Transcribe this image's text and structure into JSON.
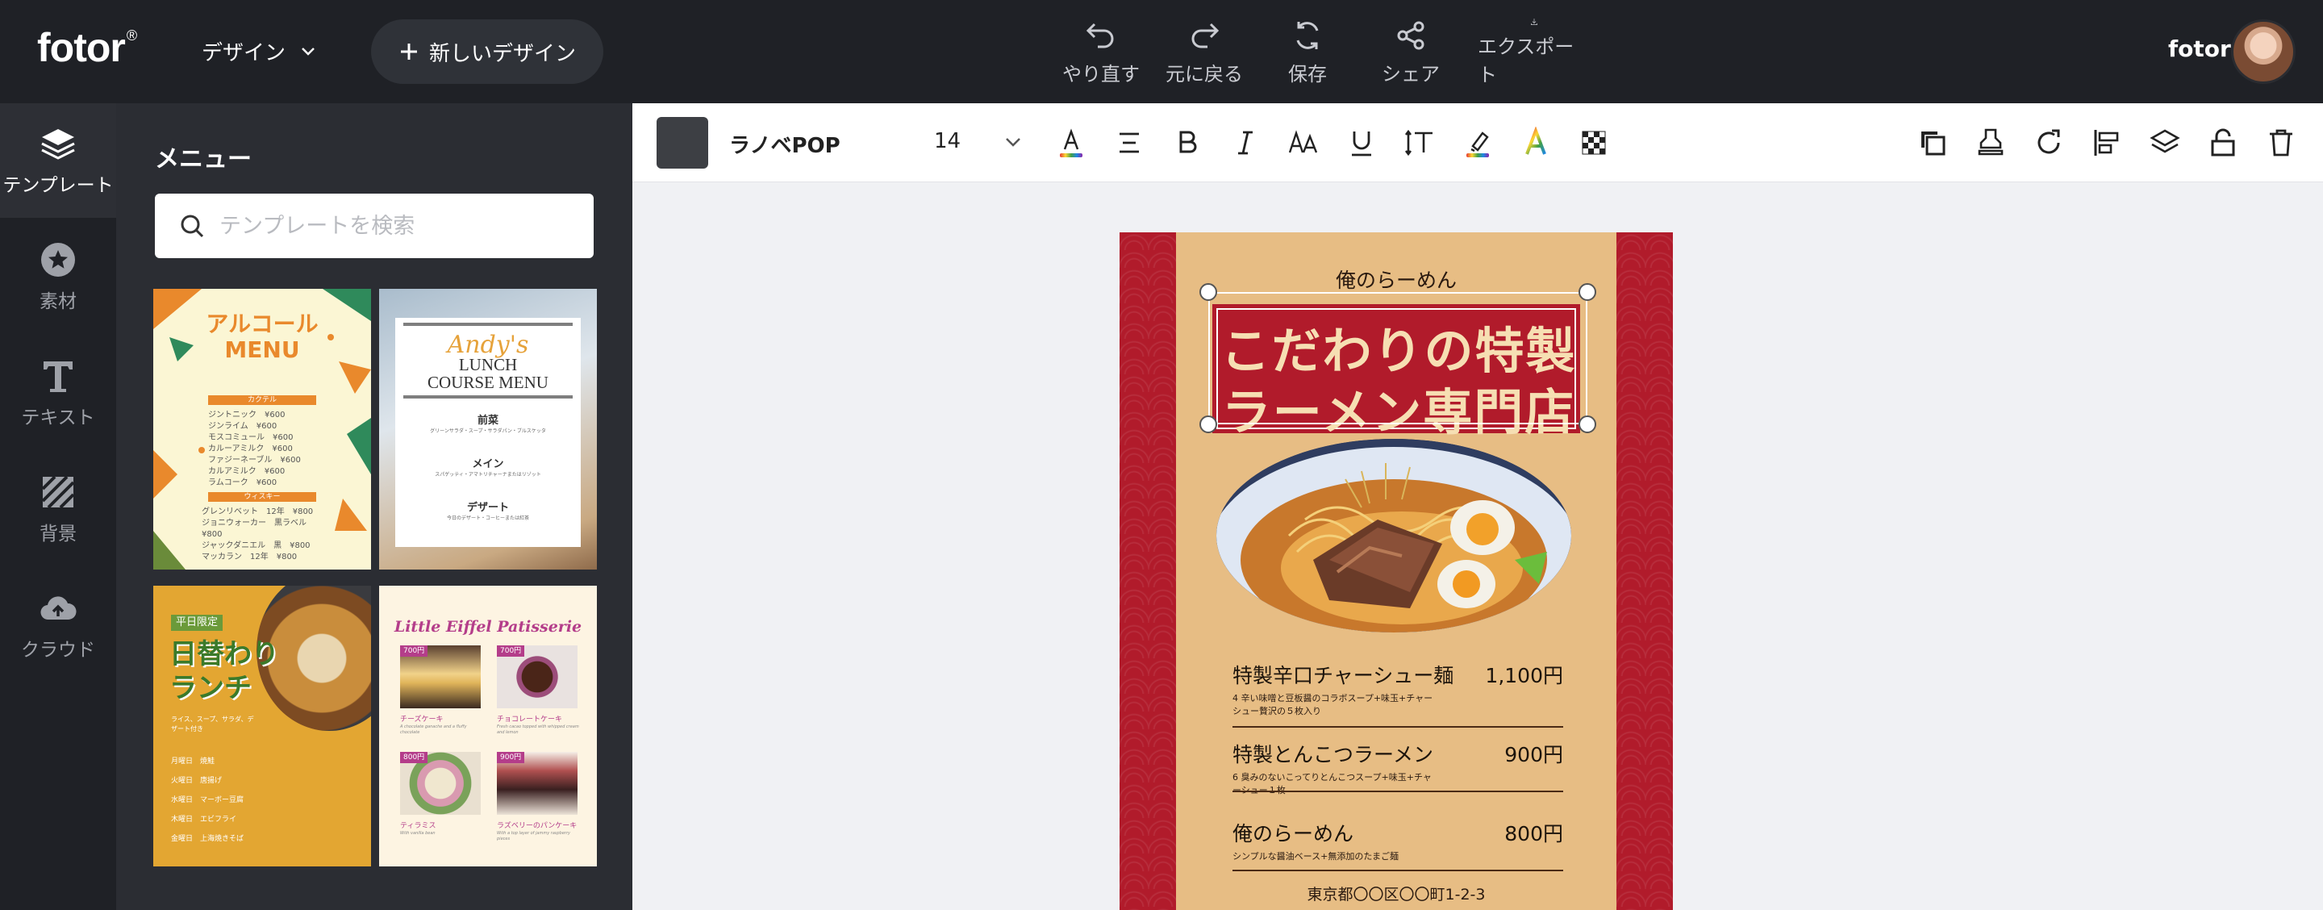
{
  "header": {
    "logo": "fotor",
    "logo_mark": "®",
    "design_menu_label": "デザイン",
    "new_design_label": "新しいデザイン",
    "tools": [
      {
        "icon": "undo-icon",
        "label": "やり直す"
      },
      {
        "icon": "redo-icon",
        "label": "元に戻る"
      },
      {
        "icon": "save-icon",
        "label": "保存"
      },
      {
        "icon": "share-icon",
        "label": "シェア"
      },
      {
        "icon": "export-icon",
        "label": "エクスポート"
      }
    ],
    "user_name": "fotor"
  },
  "rail": {
    "items": [
      {
        "icon": "layers-icon",
        "label": "テンプレート",
        "active": true
      },
      {
        "icon": "star-icon",
        "label": "素材"
      },
      {
        "icon": "text-icon",
        "label": "テキスト"
      },
      {
        "icon": "background-icon",
        "label": "背景"
      },
      {
        "icon": "cloud-icon",
        "label": "クラウド"
      }
    ]
  },
  "panel": {
    "title": "メニュー",
    "search_placeholder": "テンプレートを検索",
    "templates": {
      "t1": {
        "title_line1": "アルコール",
        "title_line2": "MENU",
        "section1": "カクテル",
        "rows1": [
          "ジントニック　¥600",
          "ジンライム　¥600",
          "モスコミュール　¥600",
          "カルーアミルク　¥600",
          "ファジーネーブル　¥600",
          "カルアミルク　¥600",
          "ラムコーク　¥600"
        ],
        "section2": "ウィスキー",
        "rows2": [
          "グレンリベット　12年　¥800",
          "ジョニウォーカー　黒ラベル　¥800",
          "ジャックダニエル　黒　¥800",
          "マッカラン　12年　¥800"
        ]
      },
      "t2": {
        "script": "Andy's",
        "title_line1": "LUNCH",
        "title_line2": "COURSE MENU",
        "s1": "前菜",
        "s1_text": "グリーンサラダ・スープ・サラダパン・ブルスケッタ",
        "s2": "メイン",
        "s2_text": "スパゲッティ・アマトリチャーナまたはリゾット",
        "s3": "デザート",
        "s3_text": "今日のデザート・コーヒーまたは紅茶"
      },
      "t3": {
        "tag": "平日限定",
        "title_line1": "日替わり",
        "title_line2": "ランチ",
        "sub": "ライス、スープ、サラダ、デザート付き",
        "days": [
          "月曜日　焼鮭",
          "火曜日　唐揚げ",
          "水曜日　マーボー豆腐",
          "木曜日　エビフライ",
          "金曜日　上海焼きそば"
        ]
      },
      "t4": {
        "title": "Little Eiffel Patisserie",
        "items": [
          {
            "price": "700円",
            "name": "チーズケーキ",
            "desc": "A chocolate ganache and a fluffy chocolate"
          },
          {
            "price": "700円",
            "name": "チョコレートケーキ",
            "desc": "Fresh cacao topped with whipped cream and lemon"
          },
          {
            "price": "800円",
            "name": "ティラミス",
            "desc": "With vanilla bean"
          },
          {
            "price": "900円",
            "name": "ラズベリーのパンケーキ",
            "desc": "With a top layer of jammy raspberry pieces"
          }
        ]
      }
    }
  },
  "toolbar": {
    "font_name": "ラノベPOP",
    "font_size": "14",
    "icons": [
      "text-color-icon",
      "align-icon",
      "bold-icon",
      "italic-icon",
      "case-icon",
      "underline-icon",
      "spacing-icon",
      "highlight-icon",
      "gradient-text-icon",
      "transparency-icon"
    ],
    "right_icons": [
      "duplicate-icon",
      "stamp-icon",
      "rotate-icon",
      "align-left-icon",
      "layers-icon",
      "lock-icon",
      "delete-icon"
    ]
  },
  "poster": {
    "shop_name": "俺のらーめん",
    "headline_line1": "こだわりの特製",
    "headline_line2": "ラーメン専門店",
    "items": [
      {
        "name": "特製辛口チャーシュー麺",
        "price": "1,100円",
        "desc": "4 辛い味噌と豆板醤のコラボスープ+味玉+チャーシュー贅沢の５枚入り"
      },
      {
        "name": "特製とんこつラーメン",
        "price": "900円",
        "desc": "6 臭みのないこってりとんこつスープ+味玉+チャーシュー１枚"
      },
      {
        "name": "俺のらーめん",
        "price": "800円",
        "desc": "シンプルな醤油ベース+無添加のたまご麺"
      }
    ],
    "address": "東京都〇〇区〇〇町1-2-3"
  },
  "colors": {
    "dark_bg": "#1f2126",
    "panel_bg": "#2b2d33",
    "poster_red": "#b11b2b",
    "poster_tan": "#e7bd84"
  }
}
